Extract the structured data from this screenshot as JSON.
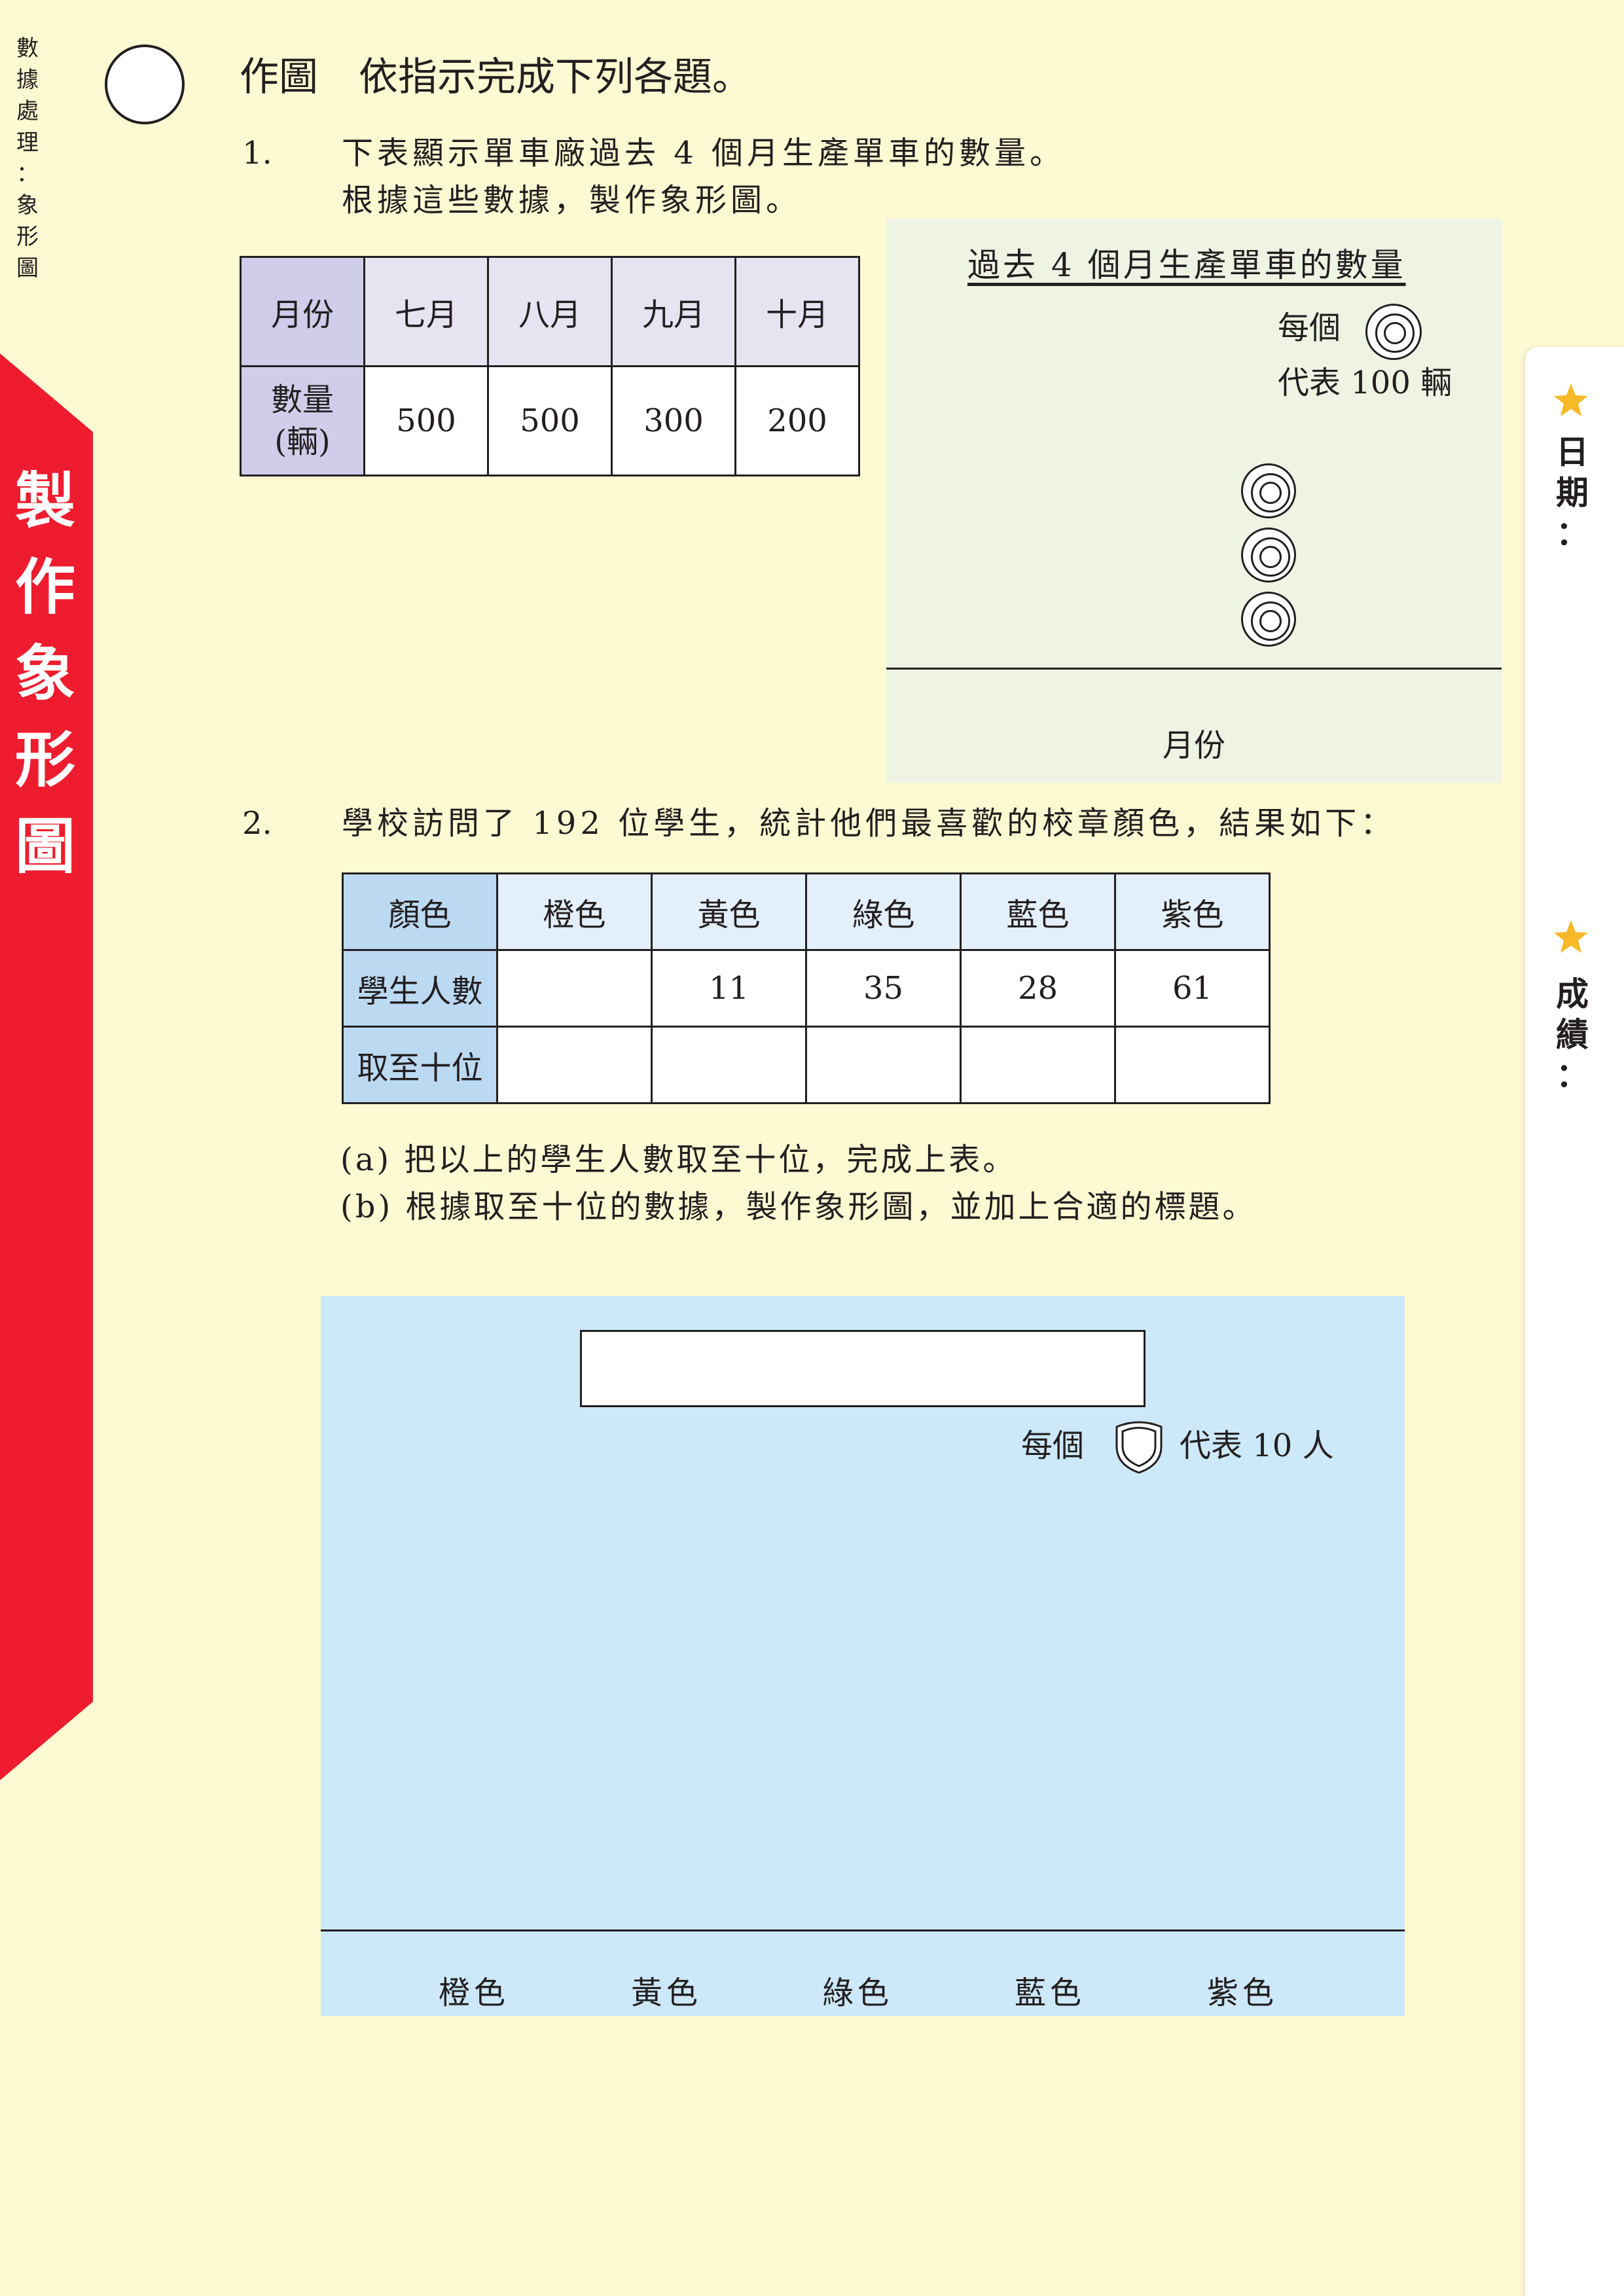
{
  "side_title": "數據處理：象形圖",
  "side_title_chars": [
    "數",
    "據",
    "處",
    "理",
    "：",
    "象",
    "形",
    "圖"
  ],
  "ribbon_title_chars": [
    "製",
    "作",
    "象",
    "形",
    "圖"
  ],
  "heading": {
    "label": "作圖",
    "instruction": "依指示完成下列各題。"
  },
  "q1": {
    "number": "1.",
    "line1": "下表顯示單車廠過去 4 個月生產單車的數量。",
    "line2": "根據這些數據，製作象形圖。",
    "table": {
      "header_label": "月份",
      "months": [
        "七月",
        "八月",
        "九月",
        "十月"
      ],
      "row_label_line1": "數量",
      "row_label_line2": "(輛)",
      "values": [
        "500",
        "500",
        "300",
        "200"
      ]
    },
    "chart": {
      "title": "過去 4 個月生產單車的數量",
      "key_prefix": "每個",
      "key_suffix": "代表 100 輛",
      "symbol_icon": "concentric-circle-icon",
      "filled_symbols": 3,
      "xlabel": "月份"
    }
  },
  "q2": {
    "number": "2.",
    "intro": "學校訪問了 192 位學生，統計他們最喜歡的校章顏色，結果如下：",
    "table": {
      "header_label": "顏色",
      "colors": [
        "橙色",
        "黃色",
        "綠色",
        "藍色",
        "紫色"
      ],
      "count_label": "學生人數",
      "counts": [
        "",
        "11",
        "35",
        "28",
        "61"
      ],
      "round_label": "取至十位",
      "rounded": [
        "",
        "",
        "",
        "",
        ""
      ]
    },
    "part_a": "(a) 把以上的學生人數取至十位，完成上表。",
    "part_b": "(b) 根據取至十位的數據，製作象形圖，並加上合適的標題。",
    "chart": {
      "title_box": "",
      "key_prefix": "每個",
      "key_suffix": "代表 10 人",
      "symbol_icon": "shield-icon",
      "categories": [
        "橙色",
        "黃色",
        "綠色",
        "藍色",
        "紫色"
      ]
    }
  },
  "side_tabs": {
    "date_label": "日期：",
    "date_chars": [
      "日",
      "期",
      "："
    ],
    "score_label": "成績：",
    "score_chars": [
      "成",
      "績",
      "："
    ]
  },
  "colors": {
    "ribbon": "#ee1c2e",
    "page": "#fdf9d2",
    "panel1": "#eef3e4",
    "panel2": "#cce8f9",
    "table1_header": "#cfcde9",
    "table2_header": "#bcd9f2"
  }
}
